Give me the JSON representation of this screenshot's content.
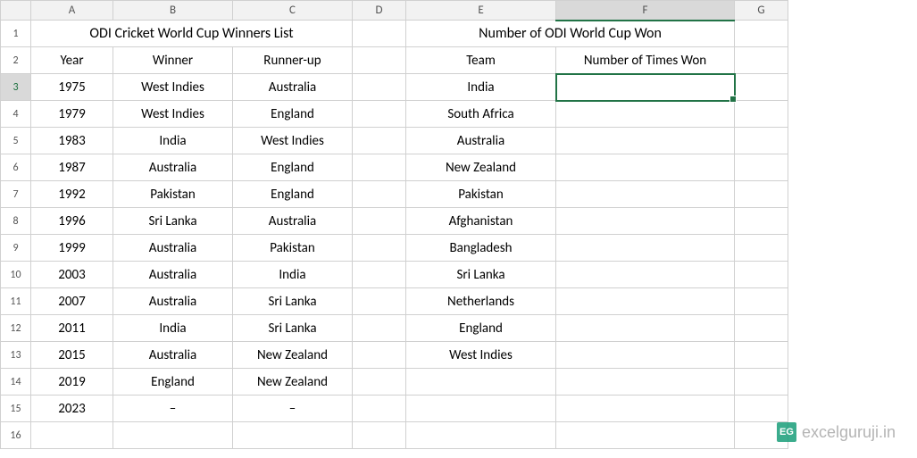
{
  "columns": {
    "A": "A",
    "B": "B",
    "C": "C",
    "D": "D",
    "E": "E",
    "F": "F",
    "G": "G"
  },
  "row_labels": [
    "1",
    "2",
    "3",
    "4",
    "5",
    "6",
    "7",
    "8",
    "9",
    "10",
    "11",
    "12",
    "13",
    "14",
    "15",
    "16"
  ],
  "titles": {
    "left": "ODI Cricket World Cup Winners List",
    "right": "Number of ODI World Cup Won"
  },
  "headers": {
    "year": "Year",
    "winner": "Winner",
    "runnerup": "Runner-up",
    "team": "Team",
    "times": "Number of Times Won"
  },
  "left_table": [
    {
      "year": "1975",
      "winner": "West Indies",
      "runnerup": "Australia"
    },
    {
      "year": "1979",
      "winner": "West Indies",
      "runnerup": "England"
    },
    {
      "year": "1983",
      "winner": "India",
      "runnerup": "West Indies"
    },
    {
      "year": "1987",
      "winner": "Australia",
      "runnerup": "England"
    },
    {
      "year": "1992",
      "winner": "Pakistan",
      "runnerup": "England"
    },
    {
      "year": "1996",
      "winner": "Sri Lanka",
      "runnerup": "Australia"
    },
    {
      "year": "1999",
      "winner": "Australia",
      "runnerup": "Pakistan"
    },
    {
      "year": "2003",
      "winner": "Australia",
      "runnerup": "India"
    },
    {
      "year": "2007",
      "winner": "Australia",
      "runnerup": "Sri Lanka"
    },
    {
      "year": "2011",
      "winner": "India",
      "runnerup": "Sri Lanka"
    },
    {
      "year": "2015",
      "winner": "Australia",
      "runnerup": "New Zealand"
    },
    {
      "year": "2019",
      "winner": "England",
      "runnerup": "New Zealand"
    },
    {
      "year": "2023",
      "winner": "–",
      "runnerup": "–"
    }
  ],
  "right_table": [
    {
      "team": "India",
      "won": ""
    },
    {
      "team": "South Africa",
      "won": ""
    },
    {
      "team": "Australia",
      "won": ""
    },
    {
      "team": "New Zealand",
      "won": ""
    },
    {
      "team": "Pakistan",
      "won": ""
    },
    {
      "team": "Afghanistan",
      "won": ""
    },
    {
      "team": "Bangladesh",
      "won": ""
    },
    {
      "team": "Sri Lanka",
      "won": ""
    },
    {
      "team": "Netherlands",
      "won": ""
    },
    {
      "team": "England",
      "won": ""
    },
    {
      "team": "West Indies",
      "won": ""
    }
  ],
  "active_cell": "F3",
  "watermark": {
    "logo": "EG",
    "text": "excelguruji.in"
  },
  "colors": {
    "header_fill": "#f4cbac",
    "selection": "#217346"
  }
}
